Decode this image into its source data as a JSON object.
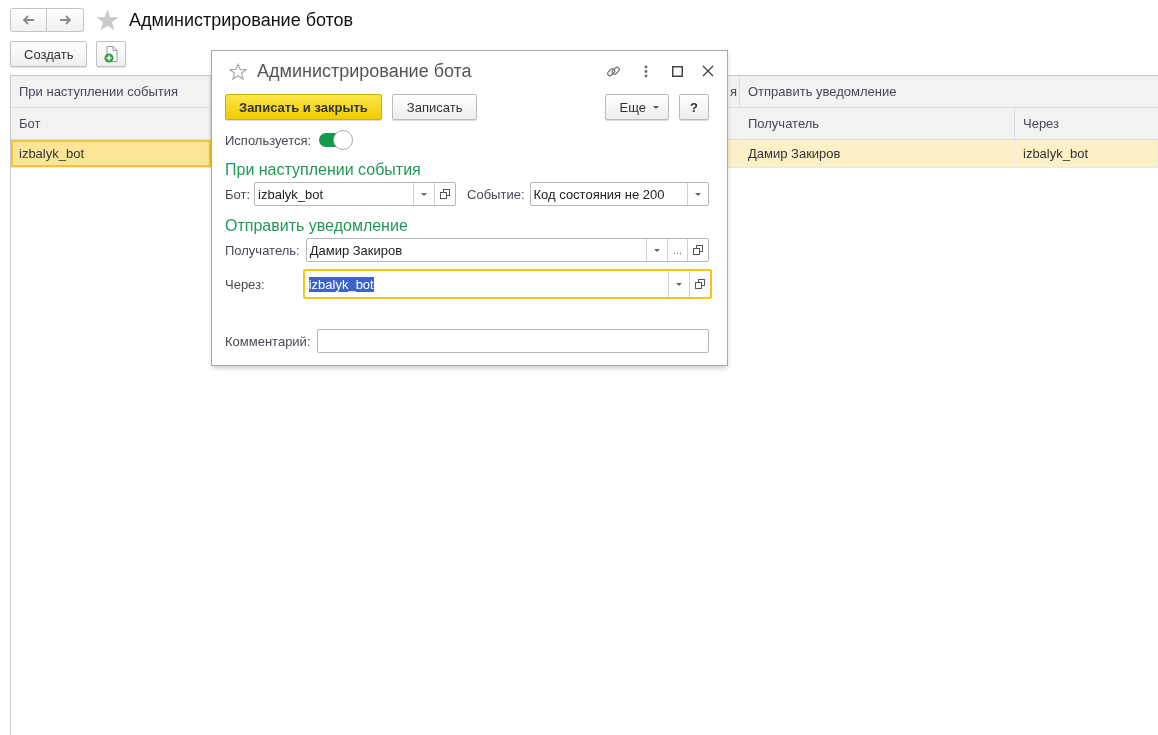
{
  "page": {
    "title": "Администрирование ботов"
  },
  "toolbar": {
    "buttons": [
      {
        "kind": "text",
        "label": "Создать"
      },
      {
        "kind": "add_icon"
      }
    ]
  },
  "table": {
    "group_headers": [
      "При наступлении события",
      "я",
      "Отправить уведомление"
    ],
    "columns": [
      "Бот",
      "Получатель",
      "Через"
    ],
    "rows": [
      {
        "selected": true,
        "cells": [
          "izbalyk_bot",
          "Дамир Закиров",
          "izbalyk_bot"
        ]
      }
    ]
  },
  "dialog": {
    "title": "Администрирование бота",
    "buttons": [
      {
        "kind": "primary",
        "label": "Записать и закрыть"
      },
      {
        "kind": "default",
        "label": "Записать"
      },
      {
        "kind": "menu",
        "label": "Еще"
      },
      {
        "kind": "help",
        "label": "?"
      }
    ],
    "toggle": {
      "label": "Используется:",
      "on": true
    },
    "sections": [
      {
        "title": "При наступлении события",
        "rows": [
          [
            {
              "label": "Бот:",
              "value": "izbalyk_bot",
              "focused": false,
              "buttons": [
                {
                  "kind": "dropdown"
                },
                {
                  "kind": "open"
                }
              ]
            },
            {
              "label": "Событие:",
              "value": "Код состояния не 200",
              "focused": false,
              "buttons": [
                {
                  "kind": "dropdown"
                }
              ]
            }
          ]
        ]
      },
      {
        "title": "Отправить уведомление",
        "rows": [
          [
            {
              "label": "Получатель:",
              "value": "Дамир Закиров",
              "focused": false,
              "buttons": [
                {
                  "kind": "dropdown"
                },
                {
                  "kind": "choose",
                  "label": "..."
                },
                {
                  "kind": "open"
                }
              ]
            }
          ],
          [
            {
              "label": "Через:",
              "value": "izbalyk_bot",
              "focused": true,
              "buttons": [
                {
                  "kind": "dropdown"
                },
                {
                  "kind": "open"
                }
              ]
            }
          ]
        ]
      }
    ],
    "comment": {
      "label": "Комментарий:"
    }
  }
}
